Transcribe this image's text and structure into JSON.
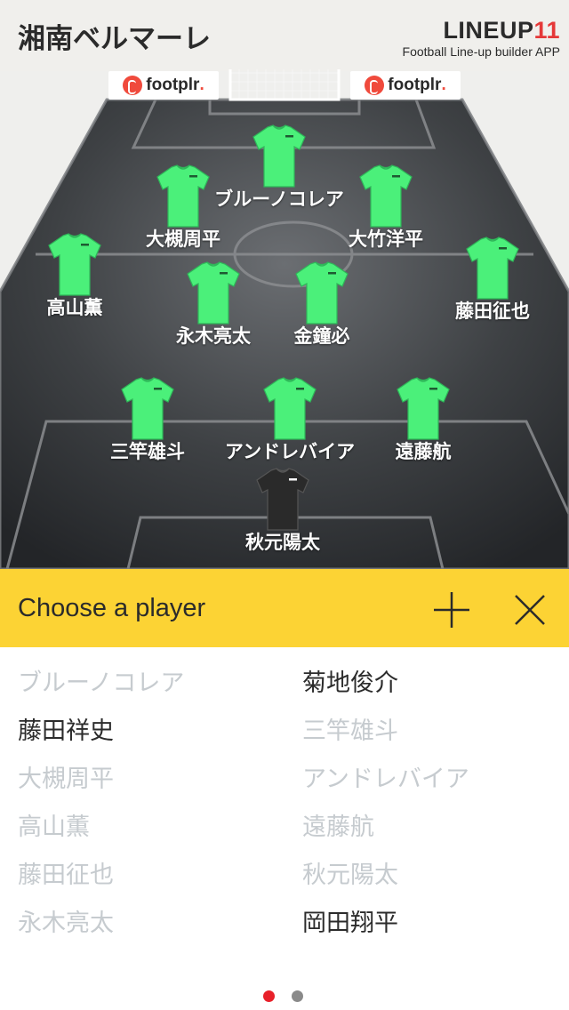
{
  "header": {
    "team_name": "湘南ベルマーレ",
    "brand_main": "LINEUP",
    "brand_num": "11",
    "brand_sub": "Football Line-up builder APP"
  },
  "sponsors": [
    {
      "label": "footplr",
      "dot": "."
    },
    {
      "label": "footplr",
      "dot": "."
    }
  ],
  "lineup": {
    "players": [
      {
        "name": "ブルーノコレア",
        "kit": "outfield"
      },
      {
        "name": "大槻周平",
        "kit": "outfield"
      },
      {
        "name": "大竹洋平",
        "kit": "outfield"
      },
      {
        "name": "高山薫",
        "kit": "outfield"
      },
      {
        "name": "藤田征也",
        "kit": "outfield"
      },
      {
        "name": "永木亮太",
        "kit": "outfield"
      },
      {
        "name": "金鐘必",
        "kit": "outfield"
      },
      {
        "name": "三竿雄斗",
        "kit": "outfield"
      },
      {
        "name": "アンドレバイア",
        "kit": "outfield"
      },
      {
        "name": "遠藤航",
        "kit": "outfield"
      },
      {
        "name": "秋元陽太",
        "kit": "goalkeeper"
      }
    ]
  },
  "chooser": {
    "title": "Choose a player",
    "add_icon": "plus-icon",
    "close_icon": "close-icon",
    "left_column": [
      {
        "name": "ブルーノコレア",
        "available": false
      },
      {
        "name": "藤田祥史",
        "available": true
      },
      {
        "name": "大槻周平",
        "available": false
      },
      {
        "name": "高山薫",
        "available": false
      },
      {
        "name": "藤田征也",
        "available": false
      },
      {
        "name": "永木亮太",
        "available": false
      }
    ],
    "right_column": [
      {
        "name": "菊地俊介",
        "available": true
      },
      {
        "name": "三竿雄斗",
        "available": false
      },
      {
        "name": "アンドレバイア",
        "available": false
      },
      {
        "name": "遠藤航",
        "available": false
      },
      {
        "name": "秋元陽太",
        "available": false
      },
      {
        "name": "岡田翔平",
        "available": true
      }
    ]
  },
  "pager": {
    "pages": 2,
    "current": 1
  },
  "colors": {
    "accent_yellow": "#fcd334",
    "kit_green": "#4bf07a",
    "keeper_kit": "#2a2a2a",
    "brand_red": "#e53838",
    "dot_active": "#e8202a",
    "dot_inactive": "#8a8a8a",
    "unavailable_text": "#c6cbcf",
    "available_text": "#2b2b2b"
  }
}
